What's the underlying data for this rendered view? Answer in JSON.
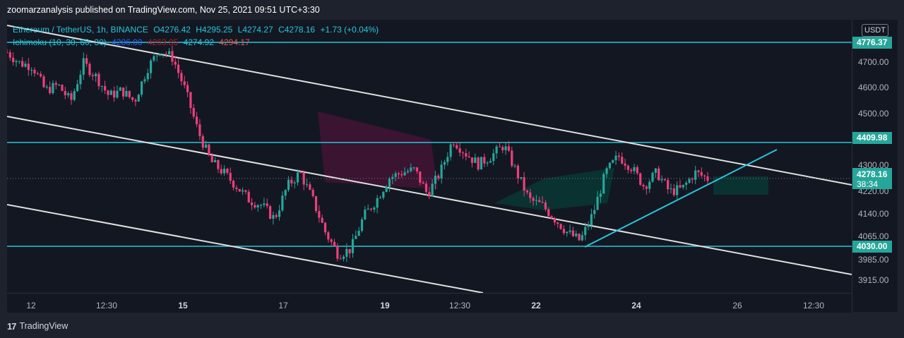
{
  "header": {
    "published": "zoomarzanalysis published on TradingView.com, Nov 25, 2021 09:51 UTC+3:30"
  },
  "legend": {
    "symbol": "Ethereum / TetherUS, 1h, BINANCE",
    "open": "O4276.42",
    "high": "H4295.25",
    "low": "L4274.27",
    "close": "C4278.16",
    "change": "+1.73 (+0.04%)",
    "indicator": "Ichimoku (10, 30, 60, 30)",
    "tenkan": "4286.00",
    "kijun": "4263.85",
    "span_a": "4274.92",
    "span_b": "4294.17"
  },
  "axis": {
    "currency": "USDT",
    "y_ticks": [
      "4700.00",
      "4600.00",
      "4500.00",
      "4300.00",
      "4220.00",
      "4140.00",
      "4065.00",
      "3985.00",
      "3915.00"
    ],
    "x_ticks": [
      "12",
      "12:30",
      "15",
      "17",
      "19",
      "12:30",
      "22",
      "24",
      "26",
      "12:30"
    ],
    "x_bold": [
      false,
      false,
      true,
      false,
      true,
      false,
      true,
      true,
      false,
      false
    ]
  },
  "levels": {
    "resistance_top": "4776.37",
    "resistance_mid": "4409.98",
    "support": "4030.00",
    "last_price": "4278.16",
    "countdown": "38:34"
  },
  "footer": {
    "brand": "TradingView"
  },
  "chart_data": {
    "type": "candlestick",
    "symbol": "ETHUSDT",
    "interval": "1h",
    "ylim": [
      3880,
      4840
    ],
    "horizontal_levels": [
      4776.37,
      4409.98,
      4030.0
    ],
    "last_price": 4278.16,
    "close_path": [
      4740,
      4700,
      4690,
      4600,
      4620,
      4560,
      4700,
      4650,
      4580,
      4600,
      4560,
      4680,
      4750,
      4720,
      4600,
      4450,
      4340,
      4300,
      4250,
      4200,
      4180,
      4130,
      4250,
      4300,
      4200,
      4080,
      4000,
      4020,
      4140,
      4200,
      4280,
      4300,
      4310,
      4220,
      4300,
      4420,
      4370,
      4330,
      4360,
      4400,
      4300,
      4200,
      4180,
      4130,
      4080,
      4050,
      4150,
      4300,
      4360,
      4320,
      4250,
      4300,
      4230,
      4240,
      4300,
      4278
    ]
  },
  "colors": {
    "background": "#131722",
    "frame": "#1e222d",
    "up_candle": "#26a69a",
    "down_candle": "#ec407a",
    "level_line": "#26c6da",
    "channel": "#e0e0e0",
    "trendline": "#26c6da"
  }
}
